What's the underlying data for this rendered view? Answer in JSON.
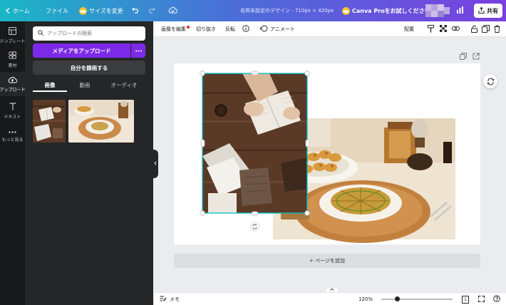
{
  "topbar": {
    "home_label": "ホーム",
    "file_label": "ファイル",
    "resize_label": "サイズを変更",
    "doc_title": "名称未設定のデザイン - 710px × 420px",
    "pro_label": "Canva Proをお試しください",
    "share_label": "共有"
  },
  "rail": {
    "items": [
      {
        "label": "テンプレート",
        "icon": "layout-icon"
      },
      {
        "label": "素材",
        "icon": "shapes-icon"
      },
      {
        "label": "アップロード",
        "icon": "cloud-upload-icon"
      },
      {
        "label": "テキスト",
        "icon": "text-icon"
      },
      {
        "label": "もっと見る",
        "icon": "more-icon"
      }
    ]
  },
  "panel": {
    "search_placeholder": "アップロードの検索",
    "upload_label": "メディアをアップロード",
    "record_label": "自分を録画する",
    "tabs": [
      "画像",
      "動画",
      "オーディオ"
    ]
  },
  "context_toolbar": {
    "edit_image": "画像を編集",
    "crop": "切り抜き",
    "flip": "反転",
    "animate": "アニメート",
    "position": "配置"
  },
  "canvas": {
    "add_page": "+ ページを追加"
  },
  "footer": {
    "notes": "メモ",
    "zoom": "120%",
    "page_count": "1"
  },
  "colors": {
    "accent": "#7d2ae8",
    "selection": "#00c4cc"
  }
}
